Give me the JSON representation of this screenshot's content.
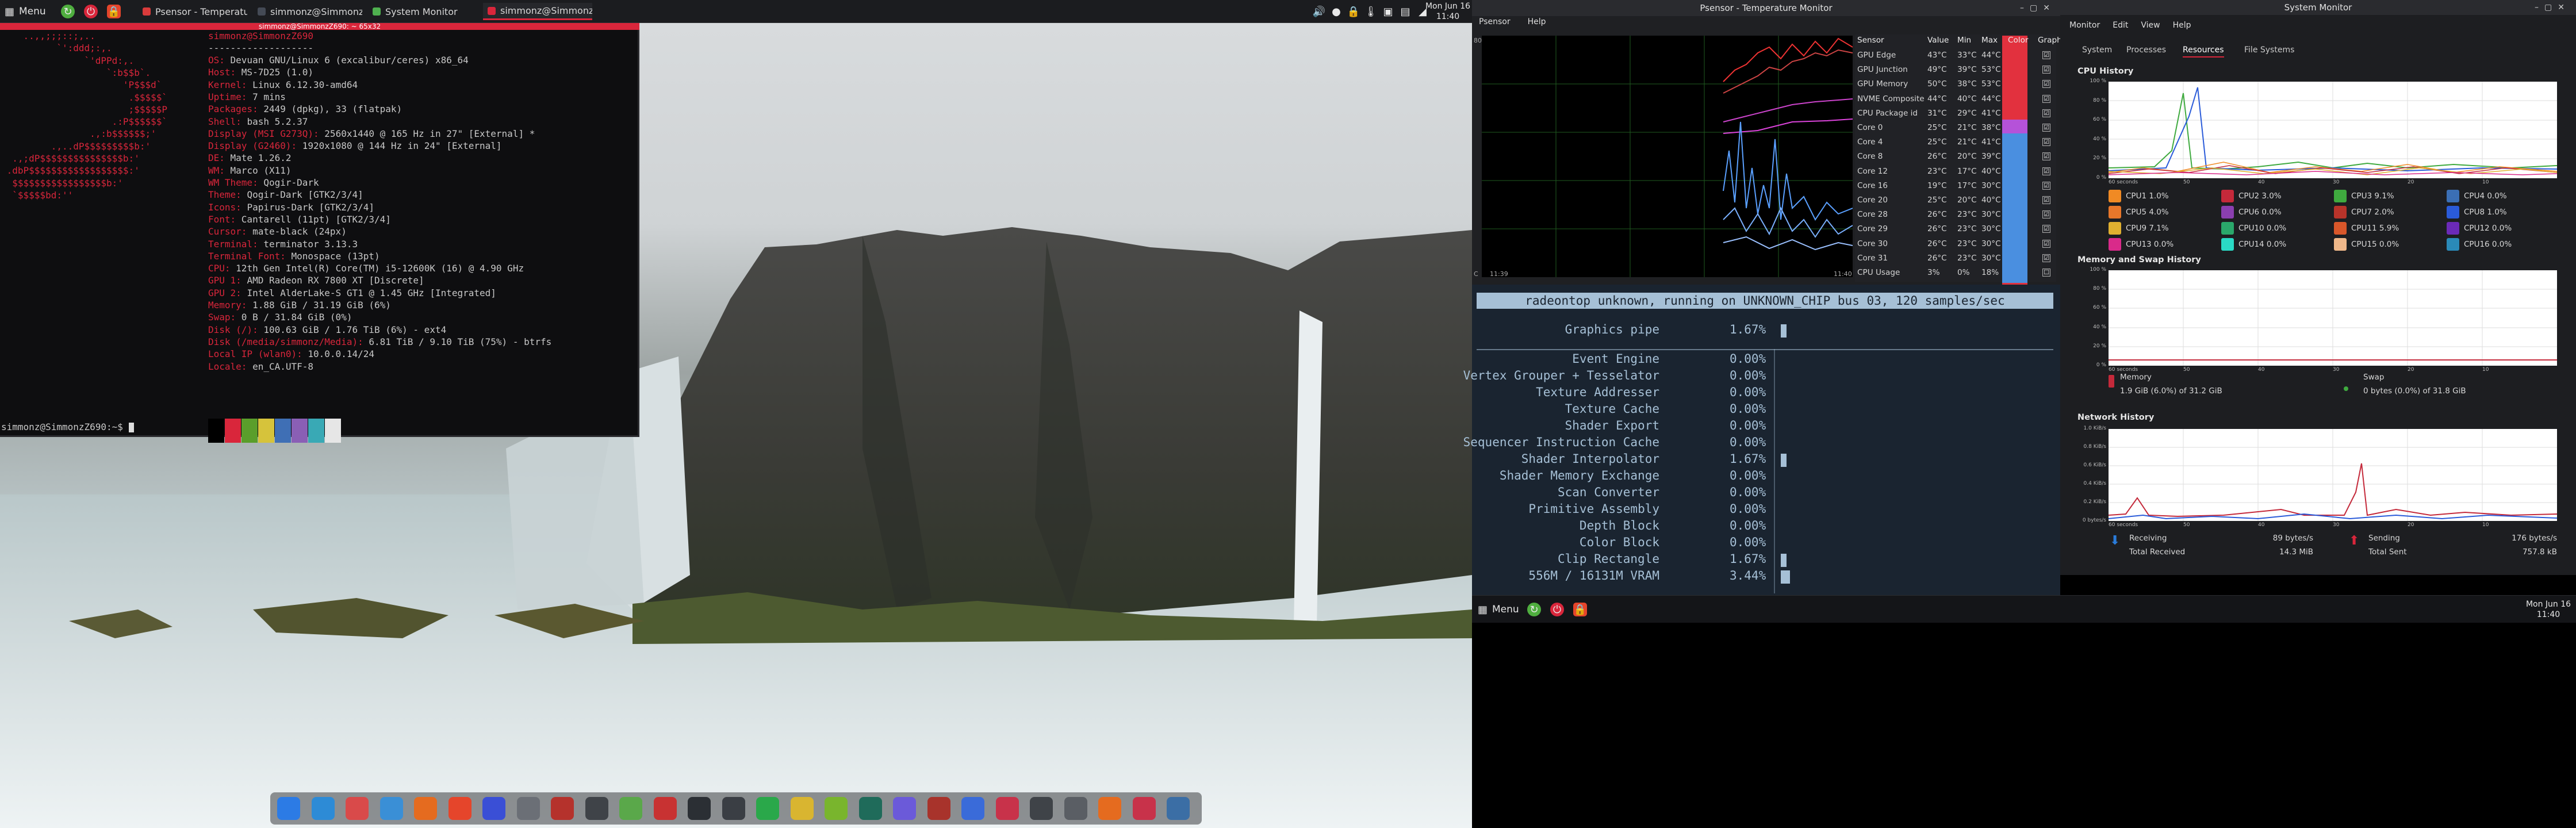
{
  "left_panel": {
    "menu_label": "Menu",
    "tasks": [
      {
        "label": "Psensor - Temperatur...",
        "color": "#d93b3b",
        "active": false
      },
      {
        "label": "simmonz@Simmonz...",
        "color": "#444a55",
        "active": false
      },
      {
        "label": "System Monitor",
        "color": "#4fb04f",
        "active": false
      },
      {
        "label": "simmonz@SimmonzZ...",
        "color": "#d9263b",
        "active": true
      }
    ],
    "clock": {
      "date": "Mon Jun 16",
      "time": "11:40"
    }
  },
  "terminal": {
    "title": "simmonz@SimmonzZ690: ~ 65x32",
    "art": [
      "    ..,,;;;::;,..",
      "          `':ddd;:,.",
      "               `'dPPd:,.",
      "                   `:b$$b`.",
      "                      'P$$$d`",
      "                       .$$$$$`",
      "                       ;$$$$$P",
      "                    .:P$$$$$$`",
      "                .,:b$$$$$$;'",
      "         .,..dP$$$$$$$$$b:'",
      "  .,;dP$$$$$$$$$$$$$$$b:'",
      " .dbP$$$$$$$$$$$$$$$$$$:'",
      "  $$$$$$$$$$$$$$$$$b:'",
      "  `$$$$$bd:''"
    ],
    "user_host": "simmonz@SimmonzZ690",
    "divider": "-------------------",
    "info": [
      {
        "k": "OS: ",
        "v": "Devuan GNU/Linux 6 (excalibur/ceres) x86_64"
      },
      {
        "k": "Host: ",
        "v": "MS-7D25 (1.0)"
      },
      {
        "k": "Kernel: ",
        "v": "Linux 6.12.30-amd64"
      },
      {
        "k": "Uptime: ",
        "v": "7 mins"
      },
      {
        "k": "Packages: ",
        "v": "2449 (dpkg), 33 (flatpak)"
      },
      {
        "k": "Shell: ",
        "v": "bash 5.2.37"
      },
      {
        "k": "Display (MSI G273Q): ",
        "v": "2560x1440 @ 165 Hz in 27\" [External] *"
      },
      {
        "k": "Display (G2460): ",
        "v": "1920x1080 @ 144 Hz in 24\" [External]"
      },
      {
        "k": "DE: ",
        "v": "Mate 1.26.2"
      },
      {
        "k": "WM: ",
        "v": "Marco (X11)"
      },
      {
        "k": "WM Theme: ",
        "v": "Qogir-Dark"
      },
      {
        "k": "Theme: ",
        "v": "Qogir-Dark [GTK2/3/4]"
      },
      {
        "k": "Icons: ",
        "v": "Papirus-Dark [GTK2/3/4]"
      },
      {
        "k": "Font: ",
        "v": "Cantarell (11pt) [GTK2/3/4]"
      },
      {
        "k": "Cursor: ",
        "v": "mate-black (24px)"
      },
      {
        "k": "Terminal: ",
        "v": "terminator 3.13.3"
      },
      {
        "k": "Terminal Font: ",
        "v": "Monospace (13pt)"
      },
      {
        "k": "CPU: ",
        "v": "12th Gen Intel(R) Core(TM) i5-12600K (16) @ 4.90 GHz"
      },
      {
        "k": "GPU 1: ",
        "v": "AMD Radeon RX 7800 XT [Discrete]"
      },
      {
        "k": "GPU 2: ",
        "v": "Intel AlderLake-S GT1 @ 1.45 GHz [Integrated]"
      },
      {
        "k": "Memory: ",
        "v": "1.88 GiB / 31.19 GiB (6%)"
      },
      {
        "k": "Swap: ",
        "v": "0 B / 31.84 GiB (0%)"
      },
      {
        "k": "Disk (/): ",
        "v": "100.63 GiB / 1.76 TiB (6%) - ext4"
      },
      {
        "k": "Disk (/media/simmonz/Media): ",
        "v": "6.81 TiB / 9.10 TiB (75%) - btrfs"
      },
      {
        "k": "Local IP (wlan0): ",
        "v": "10.0.0.14/24"
      },
      {
        "k": "Locale: ",
        "v": "en_CA.UTF-8"
      }
    ],
    "prompt": "simmonz@SimmonzZ690:~$ ",
    "palette": [
      "#000000",
      "#d9263b",
      "#5a9e2b",
      "#d6c33b",
      "#3f6fb5",
      "#8a5fb5",
      "#39a9b5",
      "#e6e6e6"
    ]
  },
  "dock": {
    "icons": [
      "files-icon",
      "network-icon",
      "disk-icon",
      "safari-icon",
      "firefox-icon",
      "brave-icon",
      "vivaldi-icon",
      "file-manager-icon",
      "archive-icon",
      "text-editor-icon",
      "maps-icon",
      "office-icon",
      "terminal-icon",
      "calculator-icon",
      "audio-icon",
      "folder-icon",
      "android-icon",
      "github-icon",
      "mail-icon",
      "game-icon",
      "bitwarden-icon",
      "record-icon",
      "screen-icon",
      "backup-icon",
      "firewall-icon",
      "arcade-icon",
      "steam-icon"
    ],
    "colors": [
      "#2c7be5",
      "#2d8bd6",
      "#d94a4a",
      "#3a8fd6",
      "#e56b1f",
      "#e5452b",
      "#3a4fd6",
      "#6b6f76",
      "#b5322c",
      "#3f4348",
      "#5aa84a",
      "#c83232",
      "#2b2f34",
      "#3a3e44",
      "#2aa84a",
      "#d9b530",
      "#79b52d",
      "#1f6b5a",
      "#6b5ad9",
      "#a8332b",
      "#3a6bd9",
      "#c8324a",
      "#3f4348",
      "#5a5e64",
      "#e56b1f",
      "#c8324a",
      "#3b6ea5"
    ]
  },
  "psensor": {
    "title": "Psensor - Temperature Monitor",
    "menu": [
      "Psensor",
      "Help"
    ],
    "graph_label_top": "80",
    "graph_label_bottom": "C",
    "graph_time_start": "11:39",
    "graph_time_end": "11:40",
    "headers": [
      "Sensor",
      "Value",
      "Min",
      "Max",
      "Color",
      "Graph"
    ],
    "rows": [
      {
        "name": "GPU Edge",
        "value": "43°C",
        "min": "33°C",
        "max": "44°C"
      },
      {
        "name": "GPU Junction",
        "value": "49°C",
        "min": "39°C",
        "max": "53°C"
      },
      {
        "name": "GPU Memory",
        "value": "50°C",
        "min": "38°C",
        "max": "53°C"
      },
      {
        "name": "NVME Composite",
        "value": "44°C",
        "min": "40°C",
        "max": "44°C"
      },
      {
        "name": "CPU Package id",
        "value": "31°C",
        "min": "29°C",
        "max": "41°C"
      },
      {
        "name": "Core 0",
        "value": "25°C",
        "min": "21°C",
        "max": "38°C"
      },
      {
        "name": "Core 4",
        "value": "25°C",
        "min": "21°C",
        "max": "41°C"
      },
      {
        "name": "Core 8",
        "value": "26°C",
        "min": "20°C",
        "max": "39°C"
      },
      {
        "name": "Core 12",
        "value": "23°C",
        "min": "17°C",
        "max": "40°C"
      },
      {
        "name": "Core 16",
        "value": "19°C",
        "min": "17°C",
        "max": "30°C"
      },
      {
        "name": "Core 20",
        "value": "25°C",
        "min": "20°C",
        "max": "40°C"
      },
      {
        "name": "Core 28",
        "value": "26°C",
        "min": "23°C",
        "max": "30°C"
      },
      {
        "name": "Core 29",
        "value": "26°C",
        "min": "23°C",
        "max": "30°C"
      },
      {
        "name": "Core 30",
        "value": "26°C",
        "min": "23°C",
        "max": "30°C"
      },
      {
        "name": "Core 31",
        "value": "26°C",
        "min": "23°C",
        "max": "30°C"
      },
      {
        "name": "CPU Usage",
        "value": "3%",
        "min": "0%",
        "max": "18%"
      }
    ],
    "graph_checks": [
      "☑",
      "☑",
      "☑",
      "☑",
      "☑",
      "☑",
      "☑",
      "☑",
      "☑",
      "☑",
      "☑",
      "☑",
      "☑",
      "☑",
      "☑",
      "☐"
    ]
  },
  "radeontop": {
    "header": "radeontop unknown, running on UNKNOWN_CHIP bus 03, 120 samples/sec",
    "rows": [
      {
        "label": "Graphics pipe",
        "pct": "1.67%",
        "fill": 0.0167
      },
      {
        "label": "Event Engine",
        "pct": "0.00%",
        "fill": 0
      },
      {
        "label": "Vertex Grouper + Tesselator",
        "pct": "0.00%",
        "fill": 0
      },
      {
        "label": "Texture Addresser",
        "pct": "0.00%",
        "fill": 0
      },
      {
        "label": "Texture Cache",
        "pct": "0.00%",
        "fill": 0
      },
      {
        "label": "Shader Export",
        "pct": "0.00%",
        "fill": 0
      },
      {
        "label": "Sequencer Instruction Cache",
        "pct": "0.00%",
        "fill": 0
      },
      {
        "label": "Shader Interpolator",
        "pct": "1.67%",
        "fill": 0.0167
      },
      {
        "label": "Shader Memory Exchange",
        "pct": "0.00%",
        "fill": 0
      },
      {
        "label": "Scan Converter",
        "pct": "0.00%",
        "fill": 0
      },
      {
        "label": "Primitive Assembly",
        "pct": "0.00%",
        "fill": 0
      },
      {
        "label": "Depth Block",
        "pct": "0.00%",
        "fill": 0
      },
      {
        "label": "Color Block",
        "pct": "0.00%",
        "fill": 0
      },
      {
        "label": "Clip Rectangle",
        "pct": "1.67%",
        "fill": 0.0167
      },
      {
        "label": "556M / 16131M VRAM",
        "pct": "3.44%",
        "fill": 0.0344
      }
    ]
  },
  "sysmon": {
    "title": "System Monitor",
    "menu": [
      "Monitor",
      "Edit",
      "View",
      "Help"
    ],
    "tabs": [
      "System",
      "Processes",
      "Resources",
      "File Systems"
    ],
    "active_tab": "Resources",
    "cpu_history": "CPU History",
    "cpu_y": [
      "100 %",
      "80 %",
      "60 %",
      "40 %",
      "20 %",
      "0 %"
    ],
    "cpu_legend": [
      {
        "label": "CPU1 1.0%",
        "color": "#f08a24"
      },
      {
        "label": "CPU2 3.0%",
        "color": "#c4293a"
      },
      {
        "label": "CPU3 9.1%",
        "color": "#3faa3f"
      },
      {
        "label": "CPU4 0.0%",
        "color": "#3b6fb5"
      },
      {
        "label": "CPU5 4.0%",
        "color": "#e8772a"
      },
      {
        "label": "CPU6 0.0%",
        "color": "#8a3fb0"
      },
      {
        "label": "CPU7 2.0%",
        "color": "#b8332a"
      },
      {
        "label": "CPU8 1.0%",
        "color": "#2a5bd9"
      },
      {
        "label": "CPU9 7.1%",
        "color": "#e0b030"
      },
      {
        "label": "CPU10 0.0%",
        "color": "#2aa86b"
      },
      {
        "label": "CPU11 5.9%",
        "color": "#d9572a"
      },
      {
        "label": "CPU12 0.0%",
        "color": "#6b2ab8"
      },
      {
        "label": "CPU13 0.0%",
        "color": "#d92a8a"
      },
      {
        "label": "CPU14 0.0%",
        "color": "#2ad9c4"
      },
      {
        "label": "CPU15 0.0%",
        "color": "#f0b88a"
      },
      {
        "label": "CPU16 0.0%",
        "color": "#2a8ab8"
      }
    ],
    "mem_history": "Memory and Swap History",
    "mem_y": [
      "100 %",
      "80 %",
      "60 %",
      "40 %",
      "20 %",
      "0 %"
    ],
    "memory_label": "Memory",
    "memory_value": "1.9 GiB (6.0%) of 31.2 GiB",
    "memory_fraction": 0.06,
    "swap_label": "Swap",
    "swap_value": "0 bytes (0.0%) of 31.8 GiB",
    "swap_fraction": 0,
    "net_history": "Network History",
    "net_y": [
      "1.0 KiB/s",
      "0.8 KiB/s",
      "0.6 KiB/s",
      "0.4 KiB/s",
      "0.2 KiB/s",
      "0 bytes/s"
    ],
    "x_labels": [
      "60 seconds",
      "50",
      "40",
      "30",
      "20",
      "10"
    ],
    "receiving_label": "Receiving",
    "receiving_value": "89 bytes/s",
    "total_received_label": "Total Received",
    "total_received_value": "14.3 MiB",
    "sending_label": "Sending",
    "sending_value": "176 bytes/s",
    "total_sent_label": "Total Sent",
    "total_sent_value": "757.8 kB"
  },
  "right_panel": {
    "menu_label": "Menu",
    "clock": {
      "date": "Mon Jun 16",
      "time": "11:40"
    }
  }
}
